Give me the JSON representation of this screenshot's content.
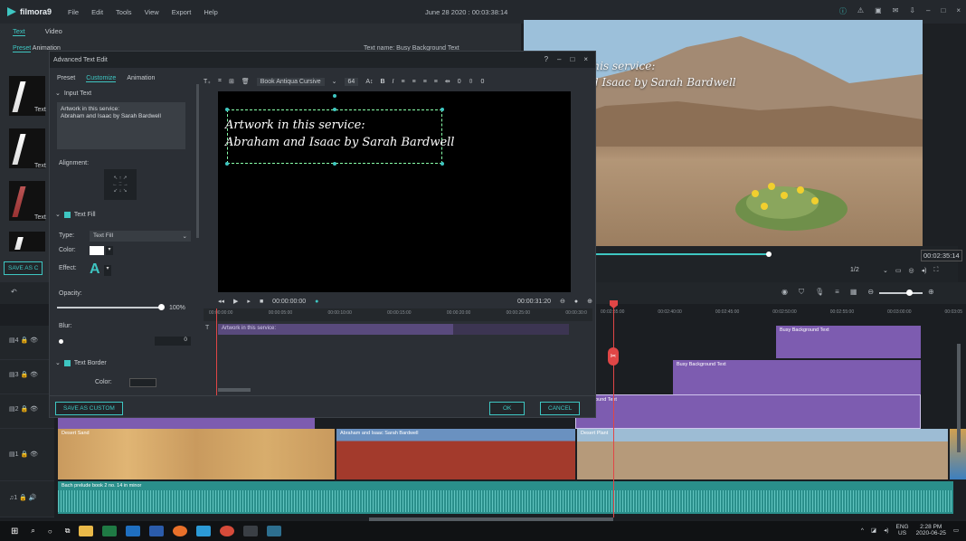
{
  "app": {
    "logo": "filmora9",
    "menu": [
      "File",
      "Edit",
      "Tools",
      "View",
      "Export",
      "Help"
    ],
    "window_title": "June 28 2020 : 00:03:38:14",
    "window_icons": [
      "info-icon",
      "alert-icon",
      "save-icon",
      "mail-icon",
      "download-icon",
      "minimize-icon",
      "maximize-icon",
      "close-icon"
    ]
  },
  "left_panel": {
    "tabs": [
      "Text",
      "Video"
    ],
    "subtab": "Preset",
    "subtab2": "Animation",
    "text_name": "Text name: Busy Background Text",
    "thumb_label": "Text",
    "save_as_custom": "SAVE AS C"
  },
  "dialog": {
    "title": "Advanced Text Edit",
    "tabs": [
      "Preset",
      "Customize",
      "Animation"
    ],
    "active_tab": "Customize",
    "input_text_label": "Input Text",
    "input_text_value": "Artwork in this service:\nAbraham and Isaac by Sarah Bardwell",
    "alignment_label": "Alignment:",
    "text_fill_label": "Text Fill",
    "type_label": "Type:",
    "type_value": "Text Fill",
    "color_label": "Color:",
    "effect_label": "Effect:",
    "effect_glyph": "A",
    "opacity_label": "Opacity:",
    "opacity_value": "100%",
    "opacity_fraction": 1.0,
    "blur_label": "Blur:",
    "blur_value": "0",
    "text_border_label": "Text Border",
    "border_color_label": "Color:",
    "font_family": "Book Antiqua Cursive",
    "font_size": "64",
    "spacing_value_1": "0",
    "spacing_value_2": "0",
    "canvas_line1": "Artwork in this service:",
    "canvas_line2": "Abraham and Isaac by Sarah Bardwell",
    "play_time": "00:00:00:00",
    "duration": "00:00:31:20",
    "ruler_ticks": [
      "00:00:00:00",
      "00:00:05:00",
      "00:00:10:00",
      "00:00:15:00",
      "00:00:20:00",
      "00:00:25:00",
      "00:00:30:0"
    ],
    "clip_label": "Artwork in this service:",
    "save_custom_btn": "SAVE AS CUSTOM",
    "ok_btn": "OK",
    "cancel_btn": "CANCEL"
  },
  "preview": {
    "line1": "n this service:",
    "line2": "and Isaac by Sarah Bardwell",
    "timecode": "00:02:35:14",
    "quality": "1/2",
    "progress_fraction": 0.61
  },
  "timeline": {
    "ruler_ticks": [
      "00:02:35:00",
      "00:02:40:00",
      "00:02:45:00",
      "00:02:50:00",
      "00:02:55:00",
      "00:03:00:00",
      "00:03:05"
    ],
    "tracks": [
      {
        "id": "4",
        "label": "4"
      },
      {
        "id": "3",
        "label": "3"
      },
      {
        "id": "2",
        "label": "2"
      },
      {
        "id": "1",
        "label": "1"
      }
    ],
    "audio_track_label": "1",
    "clip_busy_bg_1": "Busy Background Text",
    "clip_busy_bg_2": "Busy Background Text",
    "clip_busy_bg_3": "Background Text",
    "clip_video_left": "Desert Sand",
    "clip_video_mid": "Abraham and Isaac Sarah Bardwell",
    "clip_video_right": "Desert Plant",
    "audio_clip": "Bach prelude book 2 no. 14 in minor"
  },
  "taskbar": {
    "lang": "ENG",
    "region": "US",
    "time": "2:28 PM",
    "date": "2020-06-25"
  },
  "colors": {
    "accent": "#3ec6c2",
    "text_clip": "#7d5cb0",
    "audio": "#2a8f8b",
    "playhead": "#e04646"
  }
}
